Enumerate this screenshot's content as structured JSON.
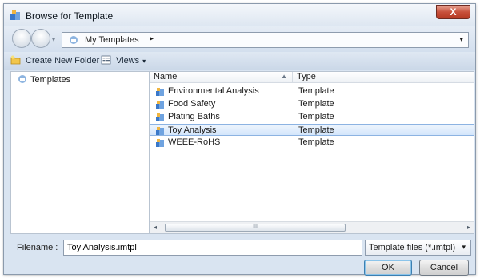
{
  "window": {
    "title": "Browse for Template",
    "close_label": "X",
    "title_icon": "template-icon"
  },
  "address": {
    "location": "My Templates",
    "arrow": "▸",
    "dropdown": "▾"
  },
  "toolbar": {
    "new_folder_label": "Create New Folder",
    "views_label": "Views",
    "views_caret": "▾"
  },
  "tree": {
    "items": [
      {
        "label": "Templates"
      }
    ]
  },
  "list": {
    "columns": {
      "name": "Name",
      "type": "Type"
    },
    "rows": [
      {
        "name": "Environmental Analysis",
        "type": "Template"
      },
      {
        "name": "Food Safety",
        "type": "Template"
      },
      {
        "name": "Plating Baths",
        "type": "Template"
      },
      {
        "name": "Toy Analysis",
        "type": "Template",
        "selected": true
      },
      {
        "name": "WEEE-RoHS",
        "type": "Template"
      }
    ],
    "scroll_left": "◂",
    "scroll_right": "▸",
    "scroll_grip": "III"
  },
  "bottom": {
    "filename_label": "Filename :",
    "filename_value": "Toy Analysis.imtpl",
    "filter_value": "Template files (*.imtpl)",
    "filter_caret": "▾",
    "ok_label": "OK",
    "cancel_label": "Cancel"
  }
}
